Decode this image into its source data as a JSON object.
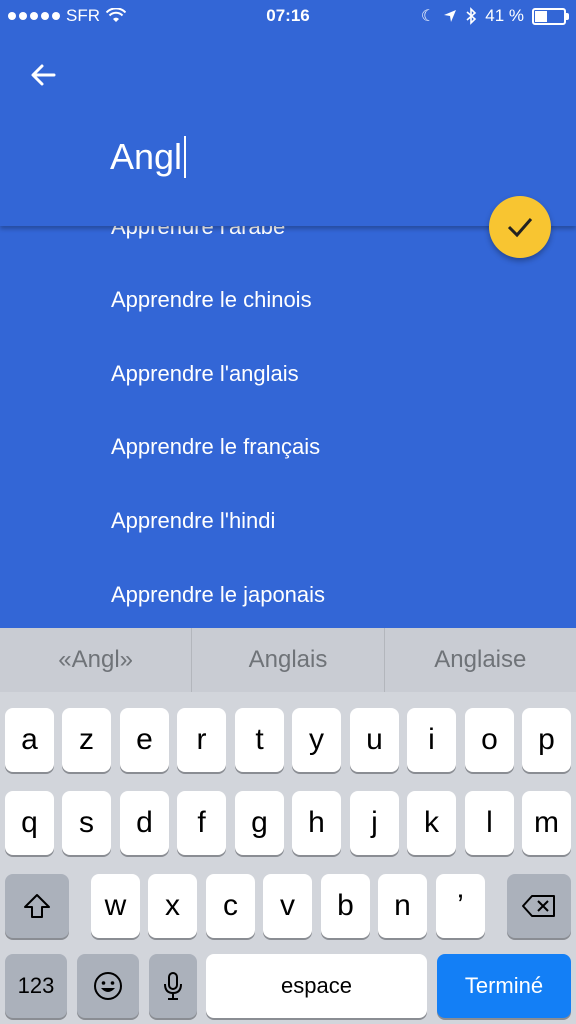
{
  "status_bar": {
    "carrier": "SFR",
    "time": "07:16",
    "battery": "41 %",
    "battery_level": 0.41
  },
  "search": {
    "query": "Angl",
    "back_icon": "arrow-left-icon",
    "confirm_icon": "check-icon"
  },
  "suggestions": [
    "Apprendre l'arabe",
    "Apprendre le chinois",
    "Apprendre l'anglais",
    "Apprendre le français",
    "Apprendre l'hindi",
    "Apprendre le japonais"
  ],
  "predictions": [
    "«Angl»",
    "Anglais",
    "Anglaise"
  ],
  "keyboard": {
    "row1": [
      "a",
      "z",
      "e",
      "r",
      "t",
      "y",
      "u",
      "i",
      "o",
      "p"
    ],
    "row2": [
      "q",
      "s",
      "d",
      "f",
      "g",
      "h",
      "j",
      "k",
      "l",
      "m"
    ],
    "row3": [
      "w",
      "x",
      "c",
      "v",
      "b",
      "n",
      "’"
    ],
    "numbers": "123",
    "space": "espace",
    "done": "Terminé"
  },
  "colors": {
    "primary": "#3366d6",
    "fab": "#f8c531",
    "done_key": "#137ff6"
  }
}
